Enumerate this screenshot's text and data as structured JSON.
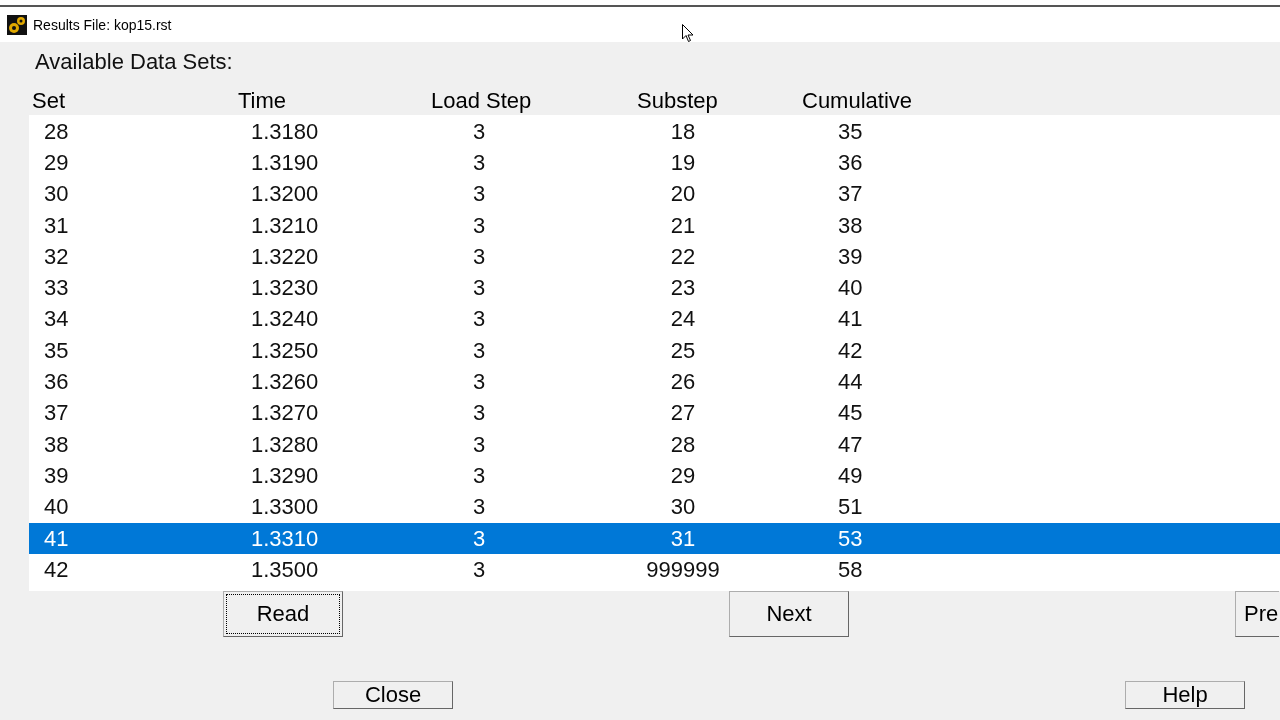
{
  "window": {
    "title": "Results File: kop15.rst"
  },
  "heading": "Available Data Sets:",
  "table": {
    "columns": [
      "Set",
      "Time",
      "Load Step",
      "Substep",
      "Cumulative"
    ],
    "rows": [
      {
        "cells": [
          "28",
          "1.3180",
          "3",
          "18",
          "35"
        ],
        "selected": false
      },
      {
        "cells": [
          "29",
          "1.3190",
          "3",
          "19",
          "36"
        ],
        "selected": false
      },
      {
        "cells": [
          "30",
          "1.3200",
          "3",
          "20",
          "37"
        ],
        "selected": false
      },
      {
        "cells": [
          "31",
          "1.3210",
          "3",
          "21",
          "38"
        ],
        "selected": false
      },
      {
        "cells": [
          "32",
          "1.3220",
          "3",
          "22",
          "39"
        ],
        "selected": false
      },
      {
        "cells": [
          "33",
          "1.3230",
          "3",
          "23",
          "40"
        ],
        "selected": false
      },
      {
        "cells": [
          "34",
          "1.3240",
          "3",
          "24",
          "41"
        ],
        "selected": false
      },
      {
        "cells": [
          "35",
          "1.3250",
          "3",
          "25",
          "42"
        ],
        "selected": false
      },
      {
        "cells": [
          "36",
          "1.3260",
          "3",
          "26",
          "44"
        ],
        "selected": false
      },
      {
        "cells": [
          "37",
          "1.3270",
          "3",
          "27",
          "45"
        ],
        "selected": false
      },
      {
        "cells": [
          "38",
          "1.3280",
          "3",
          "28",
          "47"
        ],
        "selected": false
      },
      {
        "cells": [
          "39",
          "1.3290",
          "3",
          "29",
          "49"
        ],
        "selected": false
      },
      {
        "cells": [
          "40",
          "1.3300",
          "3",
          "30",
          "51"
        ],
        "selected": false
      },
      {
        "cells": [
          "41",
          "1.3310",
          "3",
          "31",
          "53"
        ],
        "selected": true
      },
      {
        "cells": [
          "42",
          "1.3500",
          "3",
          "999999",
          "58"
        ],
        "selected": false
      }
    ]
  },
  "buttons": [
    {
      "label": "Read",
      "focused": true
    },
    {
      "label": "Next",
      "focused": false
    },
    {
      "label": "Pre",
      "focused": false
    }
  ],
  "bottom_buttons": [
    {
      "label": "Close"
    },
    {
      "label": "Help"
    }
  ]
}
